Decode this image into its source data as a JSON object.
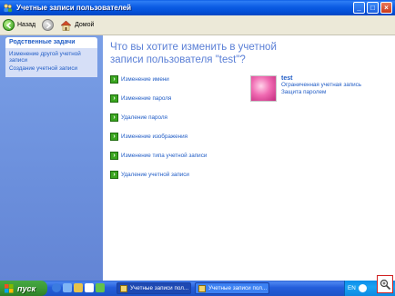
{
  "window": {
    "title": "Учетные записи пользователей",
    "controls": {
      "minimize": "_",
      "maximize": "□",
      "close": "×"
    }
  },
  "toolbar": {
    "back_label": "Назад",
    "forward_label": "",
    "home_label": "Домой"
  },
  "sidebar": {
    "panel_title": "Родственные задачи",
    "links": [
      "Изменение другой учетной записи",
      "Создание учетной записи"
    ]
  },
  "main": {
    "heading": "Что вы хотите изменить в учетной записи пользователя \"test\"?",
    "tasks": [
      "Изменение имени",
      "Изменение пароля",
      "Удаление пароля",
      "Изменение изображения",
      "Изменение типа учетной записи",
      "Удаление учетной записи"
    ]
  },
  "user": {
    "name": "test",
    "account_type": "Ограниченная учетная запись",
    "password_status": "Защита паролем"
  },
  "taskbar": {
    "start_label": "пуск",
    "buttons": [
      "Учетные записи пол...",
      "Учетные записи пол..."
    ],
    "language": "EN"
  },
  "colors": {
    "accent_link": "#215dc6",
    "heading": "#5a7fd6",
    "sidebar": "#6b8fdc",
    "titlebar": "#0c5ce4",
    "start_green": "#3c9a36"
  },
  "icons": {
    "app": "users-icon",
    "back": "back-arrow-icon",
    "forward": "forward-arrow-icon",
    "home": "home-icon",
    "task": "green-arrow-icon",
    "start": "windows-flag-icon",
    "zoom": "magnifier-icon"
  }
}
